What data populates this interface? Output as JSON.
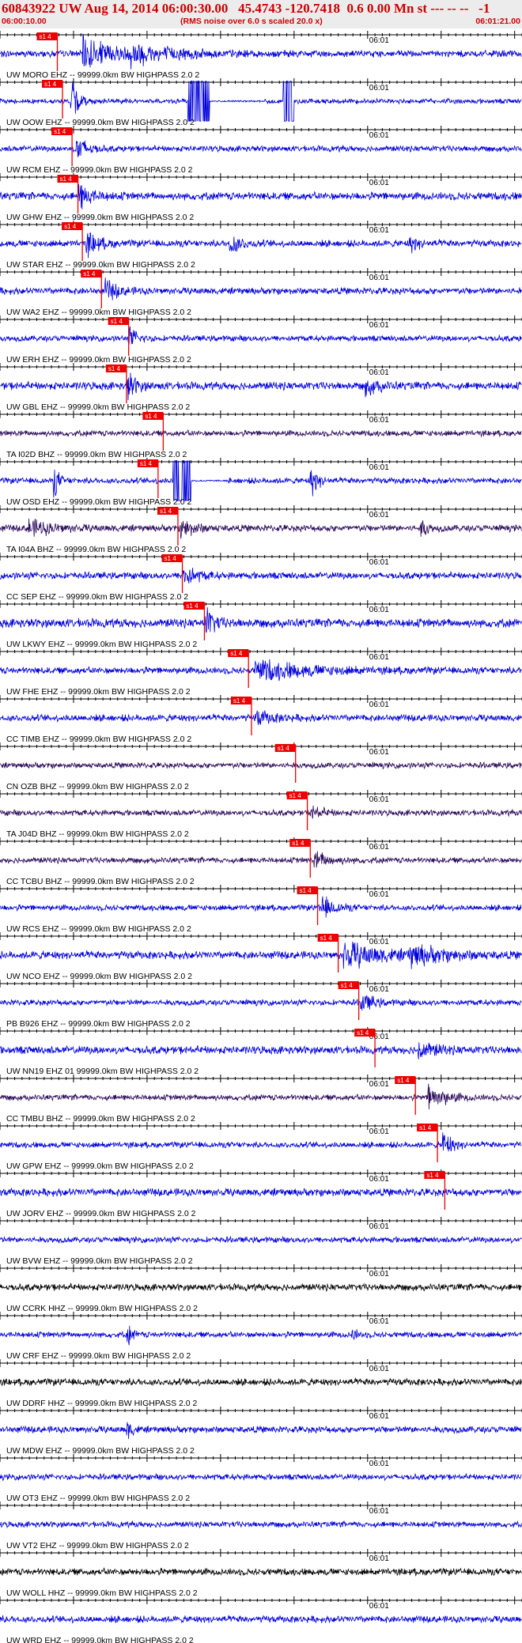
{
  "header": {
    "title": "60843922 UW Aug 14, 2014 06:00:30.00   45.4743 -120.7418  0.6 0.00 Mn st --- -- --   -1",
    "start_time": "06:00:10.00",
    "rms_note": "(RMS noise over 6.0 s scaled 20.0 x)",
    "end_time": "06:01:21.00"
  },
  "colors": {
    "title_red": "#cc0000",
    "pick_red": "#ee0000",
    "trace_blue": "#0000dd",
    "trace_purple": "#2a0a5a",
    "trace_black": "#000000",
    "axis": "#000000",
    "header_bg": "#ececec"
  },
  "chart_data": {
    "type": "line",
    "x_axis": {
      "start": "06:00:10.00",
      "end": "06:01:21.00",
      "minute_label": "06:01"
    },
    "pick_label": "s1 4",
    "filter": "BW HIGHPASS 2.0 2",
    "series": [
      {
        "label": "UW MORO EHZ -- 99999.0km BW  HIGHPASS  2.0  2",
        "color": "blue",
        "amplitude": 0.35,
        "pick_s": 17.8,
        "bursts": [
          {
            "t": 21.5,
            "a": 1.6,
            "w": 4.5
          },
          {
            "t": 28,
            "a": 0.9,
            "w": 5
          }
        ]
      },
      {
        "label": "UW OOW EHZ -- 99999.0km BW  HIGHPASS  2.0  2",
        "color": "blue",
        "amplitude": 0.25,
        "pick_s": 18.5,
        "bursts": [
          {
            "t": 19.8,
            "a": 2.2,
            "w": 0.8
          }
        ],
        "clips": [
          [
            35.5,
            38.5
          ],
          [
            48.5,
            50
          ]
        ],
        "flats": [
          [
            38.5,
            46
          ]
        ]
      },
      {
        "label": "UW RCM EHZ -- 99999.0km BW  HIGHPASS  2.0  2",
        "color": "blue",
        "amplitude": 0.3,
        "pick_s": 19.8,
        "bursts": [
          {
            "t": 20.5,
            "a": 1.6,
            "w": 1.2
          }
        ]
      },
      {
        "label": "UW GHW EHZ -- 99999.0km BW  HIGHPASS  2.0  2",
        "color": "blue",
        "amplitude": 0.4,
        "pick_s": 20.6,
        "bursts": [
          {
            "t": 21,
            "a": 1.2,
            "w": 1.5
          }
        ]
      },
      {
        "label": "UW STAR EHZ -- 99999.0km BW  HIGHPASS  2.0  2",
        "color": "blue",
        "amplitude": 0.35,
        "pick_s": 21.2,
        "bursts": [
          {
            "t": 22,
            "a": 1.1,
            "w": 1.5
          },
          {
            "t": 41.5,
            "a": 1.1,
            "w": 1.2
          },
          {
            "t": 66,
            "a": 0.7,
            "w": 1
          }
        ]
      },
      {
        "label": "UW WA2 EHZ -- 99999.0km BW  HIGHPASS  2.0  2",
        "color": "blue",
        "amplitude": 0.35,
        "pick_s": 23.8,
        "bursts": [
          {
            "t": 24.5,
            "a": 1.0,
            "w": 1.5
          }
        ]
      },
      {
        "label": "UW ERH EHZ -- 99999.0km BW  HIGHPASS  2.0  2",
        "color": "blue",
        "amplitude": 0.3,
        "pick_s": 27.5,
        "bursts": [
          {
            "t": 27.8,
            "a": 1.0,
            "w": 1
          }
        ]
      },
      {
        "label": "UW GBL EHZ -- 99999.0km BW  HIGHPASS  2.0  2",
        "color": "blue",
        "amplitude": 0.4,
        "pick_s": 27.2,
        "bursts": [
          {
            "t": 27.5,
            "a": 1.3,
            "w": 1
          },
          {
            "t": 60,
            "a": 0.8,
            "w": 1.5
          }
        ]
      },
      {
        "label": "TA I02D BHZ -- 99999.0km BW  HIGHPASS  2.0  2",
        "color": "purple",
        "amplitude": 0.3,
        "pick_s": 32.2,
        "bursts": []
      },
      {
        "label": "UW OSD EHZ -- 99999.0km BW  HIGHPASS  2.0  2",
        "color": "blue",
        "amplitude": 0.3,
        "pick_s": 31.5,
        "bursts": [
          {
            "t": 17.5,
            "a": 1.4,
            "w": 0.6
          },
          {
            "t": 52.5,
            "a": 1.4,
            "w": 0.8
          }
        ],
        "clips": [
          [
            33.5,
            36
          ]
        ],
        "flats": [
          [
            36,
            41
          ]
        ]
      },
      {
        "label": "TA I04A BHZ -- 99999.0km BW  HIGHPASS  2.0  2",
        "color": "purple",
        "amplitude": 0.35,
        "pick_s": 34.2,
        "bursts": [
          {
            "t": 14,
            "a": 0.8,
            "w": 3
          },
          {
            "t": 34.8,
            "a": 1.0,
            "w": 1.5
          },
          {
            "t": 67.5,
            "a": 1.0,
            "w": 0.6
          }
        ]
      },
      {
        "label": "CC SEP EHZ -- 99999.0km BW  HIGHPASS  2.0  2",
        "color": "blue",
        "amplitude": 0.35,
        "pick_s": 34.8,
        "bursts": [
          {
            "t": 35.2,
            "a": 1.1,
            "w": 1.5
          }
        ]
      },
      {
        "label": "UW LKWY EHZ -- 99999.0km BW  HIGHPASS  2.0  2",
        "color": "blue",
        "amplitude": 0.45,
        "pick_s": 37.8,
        "bursts": [
          {
            "t": 38.2,
            "a": 1.4,
            "w": 1
          }
        ]
      },
      {
        "label": "UW FHE EHZ -- 99999.0km BW  HIGHPASS  2.0  2",
        "color": "blue",
        "amplitude": 0.35,
        "pick_s": 43.8,
        "bursts": [
          {
            "t": 45,
            "a": 1.1,
            "w": 6
          }
        ]
      },
      {
        "label": "CC TIMB EHZ -- 99999.0km BW  HIGHPASS  2.0  2",
        "color": "blue",
        "amplitude": 0.35,
        "pick_s": 44.2,
        "bursts": [
          {
            "t": 45,
            "a": 0.7,
            "w": 2
          }
        ]
      },
      {
        "label": "CN OZB BHZ -- 99999.0km BW  HIGHPASS  2.0  2",
        "color": "purple",
        "amplitude": 0.3,
        "pick_s": 50.2,
        "bursts": []
      },
      {
        "label": "TA J04D BHZ -- 99999.0km BW  HIGHPASS  2.0  2",
        "color": "purple",
        "amplitude": 0.3,
        "pick_s": 51.8,
        "bursts": [
          {
            "t": 52.5,
            "a": 0.6,
            "w": 1.5
          }
        ]
      },
      {
        "label": "CC TCBU BHZ -- 99999.0km BW  HIGHPASS  2.0  2",
        "color": "purple",
        "amplitude": 0.3,
        "pick_s": 52.2,
        "bursts": [
          {
            "t": 53,
            "a": 0.8,
            "w": 2
          }
        ]
      },
      {
        "label": "UW RCS EHZ -- 99999.0km BW  HIGHPASS  2.0  2",
        "color": "blue",
        "amplitude": 0.3,
        "pick_s": 53.2,
        "bursts": [
          {
            "t": 53.8,
            "a": 1.2,
            "w": 1.5
          }
        ]
      },
      {
        "label": "UW NCO EHZ -- 99999.0km BW  HIGHPASS  2.0  2",
        "color": "blue",
        "amplitude": 0.4,
        "pick_s": 56,
        "bursts": [
          {
            "t": 57,
            "a": 1.3,
            "w": 5
          },
          {
            "t": 66,
            "a": 0.9,
            "w": 4
          }
        ]
      },
      {
        "label": "PB B926 EHZ -- 99999.0km BW  HIGHPASS  2.0  2",
        "color": "blue",
        "amplitude": 0.3,
        "pick_s": 58.8,
        "bursts": [
          {
            "t": 59.3,
            "a": 0.9,
            "w": 1.5
          }
        ]
      },
      {
        "label": "UW NN19 EHZ 01 99999.0km BW  HIGHPASS  2.0  2",
        "color": "blue",
        "amplitude": 0.4,
        "pick_s": 61,
        "bursts": [
          {
            "t": 67,
            "a": 0.9,
            "w": 2
          }
        ]
      },
      {
        "label": "CC TMBU BHZ -- 99999.0km BW  HIGHPASS  2.0  2",
        "color": "purple",
        "amplitude": 0.3,
        "pick_s": 66.5,
        "bursts": [
          {
            "t": 68.5,
            "a": 1.3,
            "w": 2
          }
        ]
      },
      {
        "label": "UW GPW EHZ -- 99999.0km BW  HIGHPASS  2.0  2",
        "color": "blue",
        "amplitude": 0.3,
        "pick_s": 69.5,
        "bursts": [
          {
            "t": 70.5,
            "a": 1.3,
            "w": 1
          }
        ]
      },
      {
        "label": "UW JORV EHZ -- 99999.0km BW  HIGHPASS  2.0  2",
        "color": "blue",
        "amplitude": 0.4,
        "pick_s": 70.5,
        "bursts": []
      },
      {
        "label": "UW BVW EHZ -- 99999.0km BW  HIGHPASS  2.0  2",
        "color": "blue",
        "amplitude": 0.3,
        "pick_s": null,
        "bursts": []
      },
      {
        "label": "UW CCRK HHZ -- 99999.0km BW  HIGHPASS  2.0  2",
        "color": "black",
        "amplitude": 0.35,
        "pick_s": null,
        "bursts": []
      },
      {
        "label": "UW CRF EHZ -- 99999.0km BW  HIGHPASS  2.0  2",
        "color": "blue",
        "amplitude": 0.3,
        "pick_s": null,
        "bursts": [
          {
            "t": 27.5,
            "a": 0.9,
            "w": 0.6
          },
          {
            "t": 58,
            "a": 0.6,
            "w": 0.6
          }
        ]
      },
      {
        "label": "UW DDRF HHZ -- 99999.0km BW  HIGHPASS  2.0  2",
        "color": "black",
        "amplitude": 0.35,
        "pick_s": null,
        "bursts": []
      },
      {
        "label": "UW MDW EHZ -- 99999.0km BW  HIGHPASS  2.0  2",
        "color": "blue",
        "amplitude": 0.35,
        "pick_s": null,
        "bursts": [
          {
            "t": 27.5,
            "a": 0.8,
            "w": 0.6
          }
        ]
      },
      {
        "label": "UW OT3 EHZ -- 99999.0km BW  HIGHPASS  2.0  2",
        "color": "blue",
        "amplitude": 0.3,
        "pick_s": null,
        "bursts": []
      },
      {
        "label": "UW VT2 EHZ -- 99999.0km BW  HIGHPASS  2.0  2",
        "color": "blue",
        "amplitude": 0.3,
        "pick_s": null,
        "bursts": []
      },
      {
        "label": "UW WOLL HHZ -- 99999.0km BW  HIGHPASS  2.0  2",
        "color": "black",
        "amplitude": 0.35,
        "pick_s": null,
        "bursts": []
      },
      {
        "label": "UW WRD EHZ -- 99999.0km BW  HIGHPASS  2.0  2",
        "color": "blue",
        "amplitude": 0.35,
        "pick_s": null,
        "bursts": []
      }
    ]
  }
}
